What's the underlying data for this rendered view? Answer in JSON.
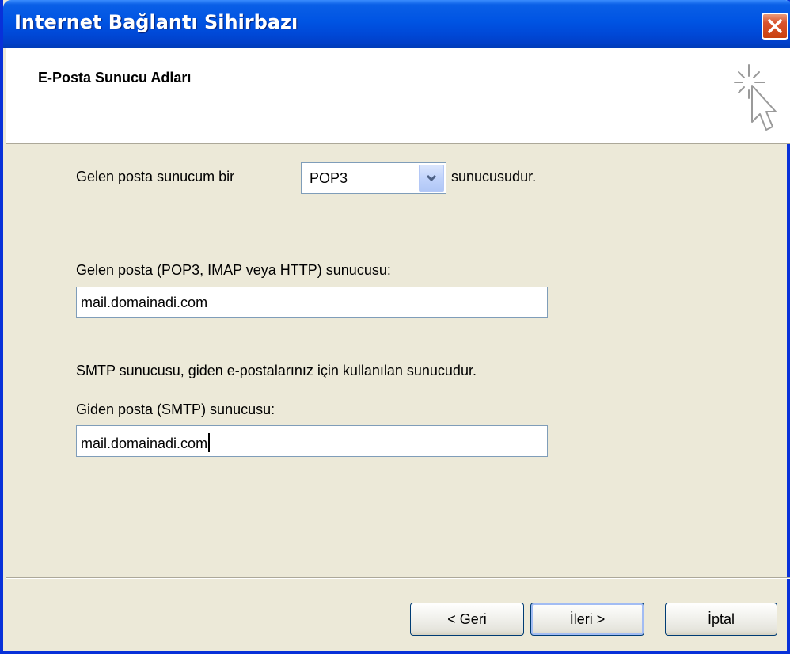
{
  "window": {
    "title": "Internet Bağlantı Sihirbazı"
  },
  "header": {
    "title": "E-Posta Sunucu Adları",
    "icon": "wizard-cursor-icon"
  },
  "incoming_type": {
    "prefix": "Gelen posta sunucum bir",
    "selected": "POP3",
    "suffix": "sunucusudur."
  },
  "incoming_server": {
    "label": "Gelen posta (POP3, IMAP veya HTTP) sunucusu:",
    "value": "mail.domainadi.com"
  },
  "smtp_note": "SMTP sunucusu, giden e-postalarınız için kullanılan sunucudur.",
  "outgoing_server": {
    "label": "Giden posta (SMTP) sunucusu:",
    "value": "mail.domainadi.com"
  },
  "buttons": {
    "back": "< Geri",
    "next": "İleri >",
    "cancel": "İptal"
  },
  "colors": {
    "titlebar": "#0054e3",
    "dialog_bg": "#ece9d8",
    "close": "#d9532e"
  }
}
